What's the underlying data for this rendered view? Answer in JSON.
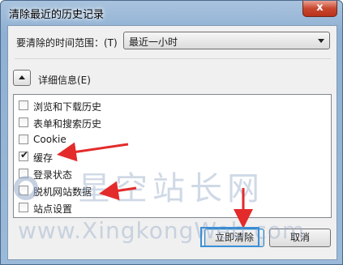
{
  "window": {
    "title": "清除最近的历史记录",
    "close_glyph": "x"
  },
  "time_range": {
    "label": "要清除的时间范围：(T)",
    "selected": "最近一小时"
  },
  "details": {
    "label": "详细信息(E)",
    "expanded": true
  },
  "history_items": [
    {
      "label": "浏览和下载历史",
      "checked": false
    },
    {
      "label": "表单和搜索历史",
      "checked": false
    },
    {
      "label": "Cookie",
      "checked": false
    },
    {
      "label": "缓存",
      "checked": true
    },
    {
      "label": "登录状态",
      "checked": false
    },
    {
      "label": "脱机网站数据",
      "checked": false
    },
    {
      "label": "站点设置",
      "checked": false
    }
  ],
  "buttons": {
    "ok": "立即清除",
    "cancel": "取消"
  },
  "watermark": {
    "cn": "星空站长网",
    "en": "www.XingkongWeb.com"
  },
  "colors": {
    "annotation_arrow": "#e32b2b",
    "highlight_box": "#3a8fd9"
  }
}
